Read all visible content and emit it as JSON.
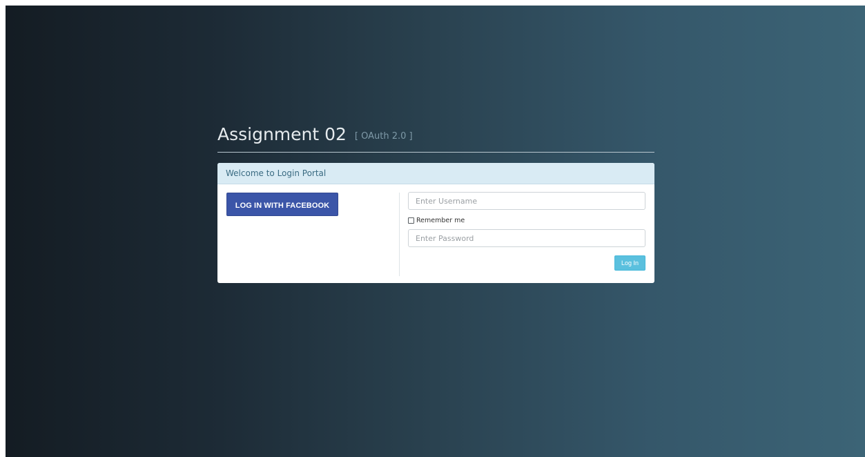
{
  "header": {
    "title": "Assignment 02",
    "subtitle": "[ OAuth 2.0 ]"
  },
  "panel": {
    "heading": "Welcome to Login Portal"
  },
  "facebook_login": {
    "label": "LOG IN WITH FACEBOOK"
  },
  "form": {
    "username": {
      "value": "",
      "placeholder": "Enter Username"
    },
    "remember_me": {
      "label": "Remember me",
      "checked": false
    },
    "password": {
      "value": "",
      "placeholder": "Enter Password"
    },
    "submit_label": "Log In"
  },
  "colors": {
    "facebook_blue": "#3b55a8",
    "login_button": "#5bc0de",
    "panel_heading_bg": "#d9ebf4",
    "background_dark": "#141c23",
    "background_light": "#3c6476"
  }
}
